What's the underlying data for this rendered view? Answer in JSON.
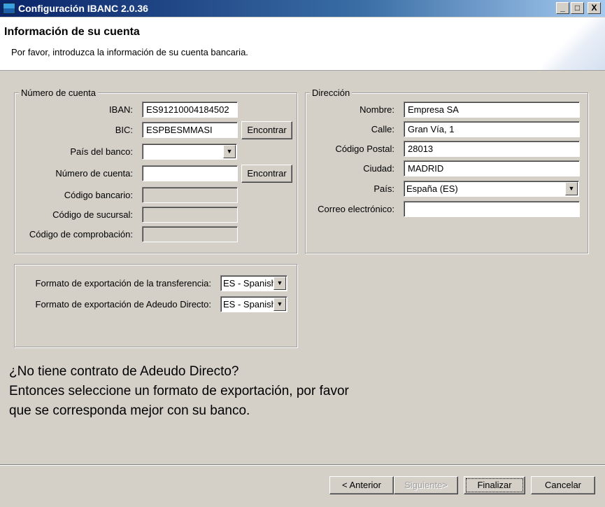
{
  "window": {
    "title": "Configuración IBANC 2.0.36",
    "min": "_",
    "max": "□",
    "close": "X"
  },
  "header": {
    "title": "Información de su cuenta",
    "subtitle": "Por favor, introduzca la información de su cuenta bancaria."
  },
  "account": {
    "legend": "Número de cuenta",
    "iban_label": "IBAN:",
    "iban_value": "ES91210004184502",
    "bic_label": "BIC:",
    "bic_value": "ESPBESMMASI",
    "find_label": "Encontrar",
    "country_label": "País del banco:",
    "country_value": "",
    "number_label": "Número de cuenta:",
    "number_value": "",
    "bank_code_label": "Código bancario:",
    "branch_code_label": "Código de sucursal:",
    "check_code_label": "Código de comprobación:"
  },
  "address": {
    "legend": "Dirección",
    "name_label": "Nombre:",
    "name_value": "Empresa SA",
    "street_label": "Calle:",
    "street_value": "Gran Vía, 1",
    "postal_label": "Código Postal:",
    "postal_value": "28013",
    "city_label": "Ciudad:",
    "city_value": "MADRID",
    "country_label": "País:",
    "country_value": "España (ES)",
    "email_label": "Correo electrónico:",
    "email_value": ""
  },
  "export": {
    "transfer_label": "Formato de exportación de la transferencia:",
    "transfer_value": "ES - Spanish",
    "debit_label": "Formato de exportación de Adeudo Directo:",
    "debit_value": "ES - Spanish"
  },
  "info": {
    "line1": "¿No tiene contrato de Adeudo Directo?",
    "line2": "Entonces seleccione un formato de exportación, por favor",
    "line3": "que se corresponda mejor con su banco."
  },
  "footer": {
    "back": "< Anterior",
    "next": "Siguiente>",
    "finish": "Finalizar",
    "cancel": "Cancelar"
  }
}
